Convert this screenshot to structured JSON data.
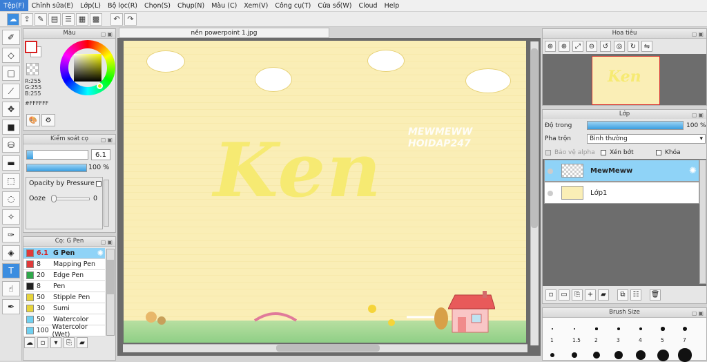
{
  "menu": [
    "Tệp(F)",
    "Chỉnh sửa(E)",
    "Lớp(L)",
    "Bộ lọc(R)",
    "Chọn(S)",
    "Chụp(N)",
    "Màu (C)",
    "Xem(V)",
    "Công cụ(T)",
    "Cửa sổ(W)",
    "Cloud",
    "Help"
  ],
  "color_panel": {
    "title": "Màu",
    "r": "R:255",
    "g": "G:255",
    "b": "B:255",
    "hex": "#FFFFFF"
  },
  "brush_control": {
    "title": "Kiểm soát cọ",
    "size": "6.1",
    "opacity": "100 %",
    "opacity_fraction": 1.0,
    "pressure_label": "Opacity by Pressure",
    "ooze_label": "Ooze",
    "ooze_value": "0"
  },
  "brush_panel": {
    "title": "Cọ: G Pen",
    "items": [
      {
        "size": "6.1",
        "name": "G Pen",
        "color": "#e03a3a",
        "selected": true
      },
      {
        "size": "8",
        "name": "Mapping Pen",
        "color": "#e03a3a"
      },
      {
        "size": "20",
        "name": "Edge Pen",
        "color": "#2fa84a"
      },
      {
        "size": "8",
        "name": "Pen",
        "color": "#222222"
      },
      {
        "size": "50",
        "name": "Stipple Pen",
        "color": "#e7d43a"
      },
      {
        "size": "30",
        "name": "Sumi",
        "color": "#e7d43a"
      },
      {
        "size": "50",
        "name": "Watercolor",
        "color": "#6fd0f0"
      },
      {
        "size": "100",
        "name": "Watercolor (Wet)",
        "color": "#6fd0f0"
      }
    ]
  },
  "document": {
    "tab": "nền powerpoint 1.jpg",
    "big_text": "Ken",
    "watermark_1": "MEWMEWW",
    "watermark_2": "HOIDAP247"
  },
  "navigator": {
    "title": "Hoa tiêu"
  },
  "layers": {
    "title": "Lớp",
    "opacity_label": "Độ trong",
    "opacity_value": "100 %",
    "opacity_fraction": 1.0,
    "blend_label": "Pha trộn",
    "blend_value": "Bình thường",
    "protect_alpha": "Bảo vệ alpha",
    "clipping": "Xén bớt",
    "lock": "Khóa",
    "items": [
      {
        "name": "MewMeww",
        "selected": true
      },
      {
        "name": "Lớp1"
      }
    ]
  },
  "brush_size": {
    "title": "Brush Size",
    "labels": [
      "1",
      "1.5",
      "2",
      "3",
      "4",
      "5",
      "7"
    ]
  },
  "colors": {
    "accent": "#3b8de0",
    "selection": "#8fd3f7",
    "canvas": "#faeeb6"
  }
}
